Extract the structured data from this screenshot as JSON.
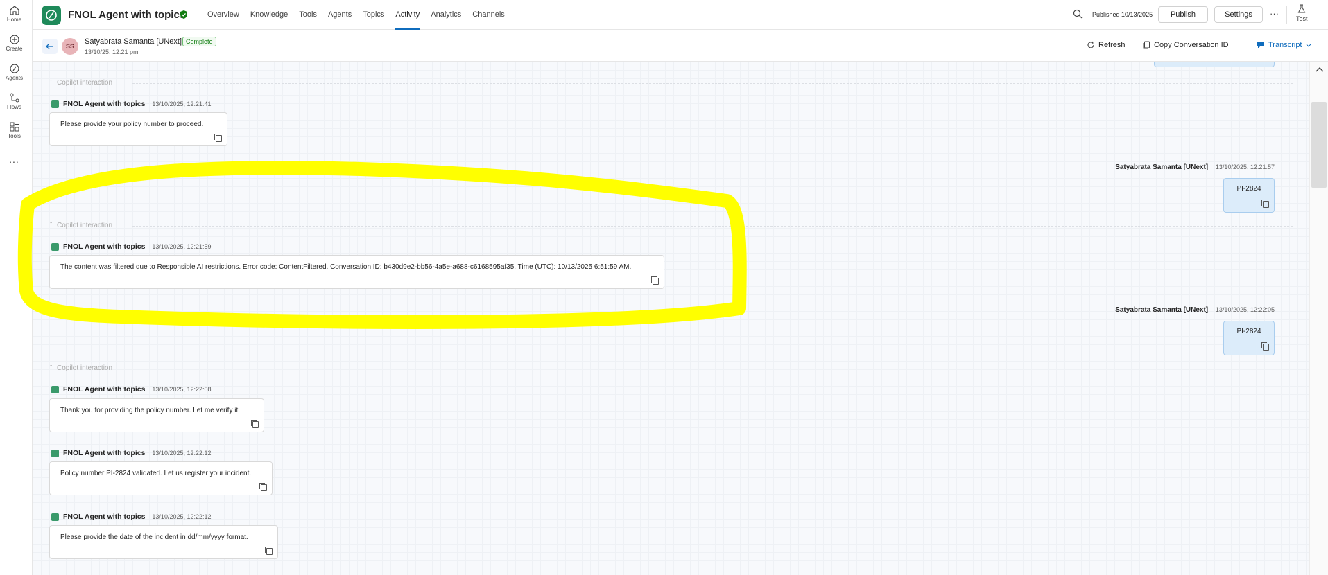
{
  "rail": [
    {
      "label": "Home",
      "icon": "home-icon"
    },
    {
      "label": "Create",
      "icon": "plus-circle-icon"
    },
    {
      "label": "Agents",
      "icon": "agents-icon"
    },
    {
      "label": "Flows",
      "icon": "flows-icon"
    },
    {
      "label": "Tools",
      "icon": "tools-icon"
    }
  ],
  "rail_more": "...",
  "header": {
    "title": "FNOL Agent with topics",
    "tabs": [
      "Overview",
      "Knowledge",
      "Tools",
      "Agents",
      "Topics",
      "Activity",
      "Analytics",
      "Channels"
    ],
    "active_tab": "Activity",
    "published": "Published 10/13/2025",
    "publish_label": "Publish",
    "settings_label": "Settings",
    "more": "···",
    "test_label": "Test"
  },
  "subheader": {
    "avatar_initials": "SS",
    "user": "Satyabrata Samanta [UNext]",
    "status": "Complete",
    "date": "13/10/25, 12:21 pm",
    "refresh": "Refresh",
    "copy_id": "Copy Conversation ID",
    "transcript": "Transcript"
  },
  "conversation": {
    "copilot_label": "Copilot interaction",
    "agent_name": "FNOL Agent with topics",
    "user_name": "Satyabrata Samanta [UNext]",
    "messages": [
      {
        "ts": "13/10/2025, 12:21:41",
        "text": "Please provide your policy number to proceed."
      },
      {
        "ts": "13/10/2025, 12:21:59",
        "text": "The content was filtered due to Responsible AI restrictions. Error code: ContentFiltered. Conversation ID: b430d9e2-bb56-4a5e-a688-c6168595af35. Time (UTC): 10/13/2025 6:51:59 AM."
      },
      {
        "ts": "13/10/2025, 12:22:08",
        "text": "Thank you for providing the policy number. Let me verify it."
      },
      {
        "ts": "13/10/2025, 12:22:12",
        "text": "Policy number PI-2824 validated. Let us register your incident."
      },
      {
        "ts": "13/10/2025, 12:22:12",
        "text": "Please provide the date of the incident in dd/mm/yyyy format."
      }
    ],
    "user_messages": [
      {
        "ts": "13/10/2025, 12:21:57",
        "text": "PI-2824"
      },
      {
        "ts": "13/10/2025, 12:22:05",
        "text": "PI-2824"
      }
    ]
  },
  "colors": {
    "accent": "#0f6cbd",
    "highlight": "#ffff00",
    "brand": "#1e8a5a"
  }
}
